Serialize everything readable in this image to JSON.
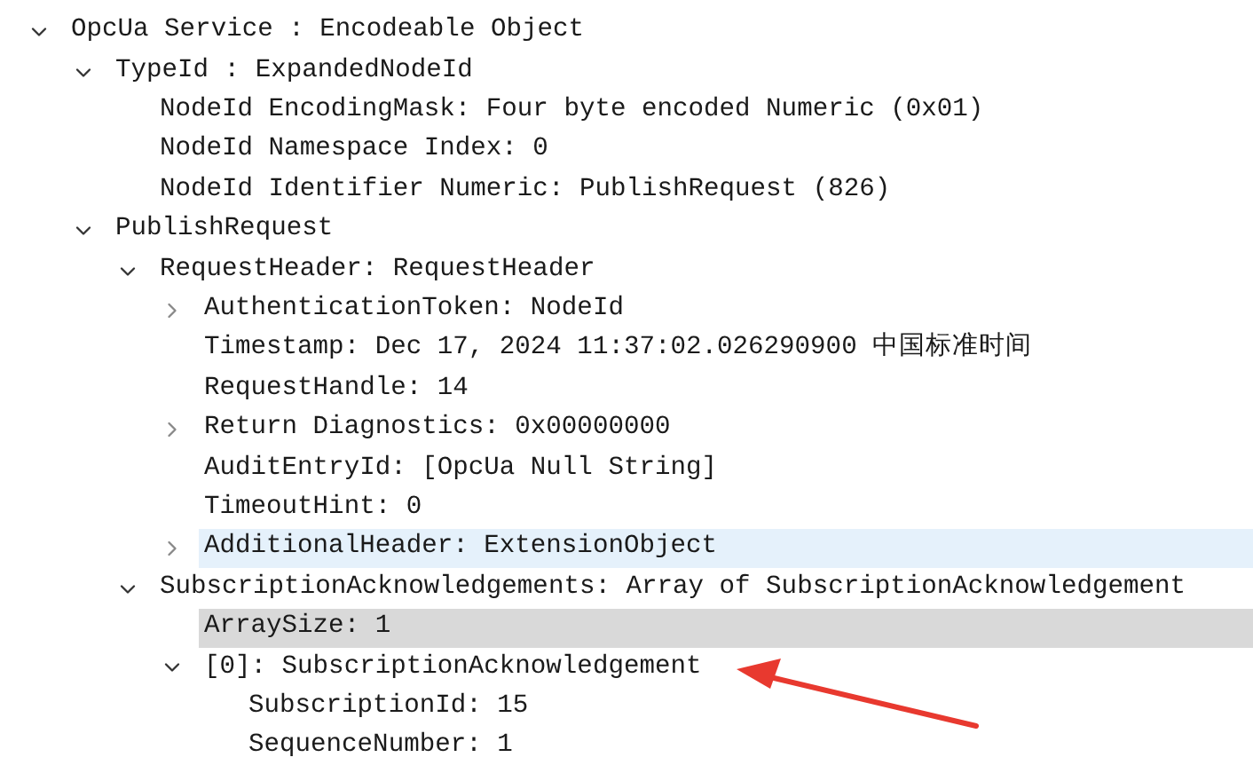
{
  "tree": [
    {
      "label": "OpcUa Service : Encodeable Object",
      "kind": "branch",
      "expanded": true,
      "selected": false,
      "hovered": false,
      "children": [
        {
          "label": "TypeId : ExpandedNodeId",
          "kind": "branch",
          "expanded": true,
          "selected": false,
          "hovered": false,
          "children": [
            {
              "label": "NodeId EncodingMask: Four byte encoded Numeric (0x01)",
              "kind": "leaf",
              "selected": false,
              "hovered": false
            },
            {
              "label": "NodeId Namespace Index: 0",
              "kind": "leaf",
              "selected": false,
              "hovered": false
            },
            {
              "label": "NodeId Identifier Numeric: PublishRequest (826)",
              "kind": "leaf",
              "selected": false,
              "hovered": false
            }
          ]
        },
        {
          "label": "PublishRequest",
          "kind": "branch",
          "expanded": true,
          "selected": false,
          "hovered": false,
          "children": [
            {
              "label": "RequestHeader: RequestHeader",
              "kind": "branch",
              "expanded": true,
              "selected": false,
              "hovered": false,
              "children": [
                {
                  "label": "AuthenticationToken: NodeId",
                  "kind": "branch",
                  "expanded": false,
                  "selected": false,
                  "hovered": false
                },
                {
                  "label": "Timestamp: Dec 17, 2024 11:37:02.026290900 中国标准时间",
                  "kind": "leaf",
                  "selected": false,
                  "hovered": false
                },
                {
                  "label": "RequestHandle: 14",
                  "kind": "leaf",
                  "selected": false,
                  "hovered": false
                },
                {
                  "label": "Return Diagnostics: 0x00000000",
                  "kind": "branch",
                  "expanded": false,
                  "selected": false,
                  "hovered": false
                },
                {
                  "label": "AuditEntryId: [OpcUa Null String]",
                  "kind": "leaf",
                  "selected": false,
                  "hovered": false
                },
                {
                  "label": "TimeoutHint: 0",
                  "kind": "leaf",
                  "selected": false,
                  "hovered": false
                },
                {
                  "label": "AdditionalHeader: ExtensionObject",
                  "kind": "branch",
                  "expanded": false,
                  "selected": false,
                  "hovered": true
                }
              ]
            },
            {
              "label": "SubscriptionAcknowledgements: Array of SubscriptionAcknowledgement",
              "kind": "branch",
              "expanded": true,
              "selected": false,
              "hovered": false,
              "children": [
                {
                  "label": "ArraySize: 1",
                  "kind": "leaf",
                  "selected": true,
                  "hovered": false
                },
                {
                  "label": "[0]: SubscriptionAcknowledgement",
                  "kind": "branch",
                  "expanded": true,
                  "selected": false,
                  "hovered": false,
                  "children": [
                    {
                      "label": "SubscriptionId: 15",
                      "kind": "leaf",
                      "selected": false,
                      "hovered": false
                    },
                    {
                      "label": "SequenceNumber: 1",
                      "kind": "leaf",
                      "selected": false,
                      "hovered": false
                    }
                  ]
                }
              ]
            }
          ]
        }
      ]
    }
  ]
}
